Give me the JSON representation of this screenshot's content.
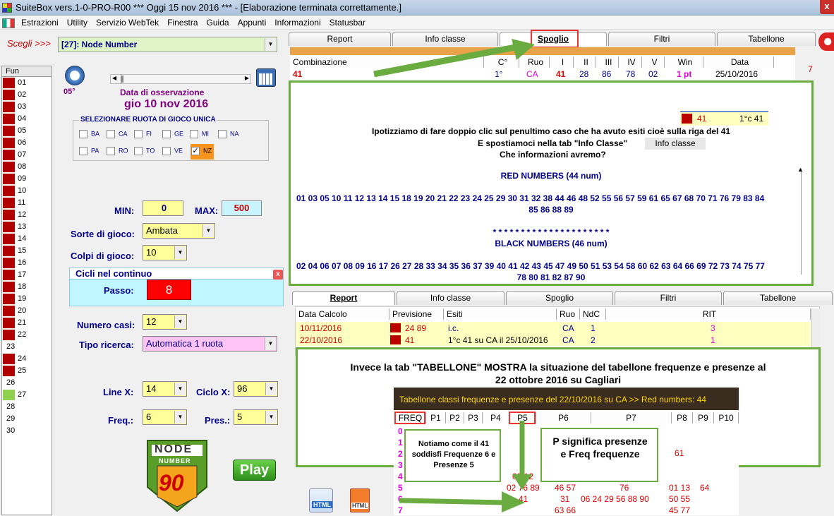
{
  "window": {
    "title": "SuiteBox vers.1-0-PRO-R00  ***  Oggi 15 nov 2016  ***  - [Elaborazione terminata correttamente.]",
    "close_glyph": "x"
  },
  "menu": {
    "items": [
      "Estrazioni",
      "Utility",
      "Servizio WebTek",
      "Finestra",
      "Guida",
      "Appunti",
      "Informazioni",
      "Statusbar"
    ]
  },
  "left": {
    "scegli_label": "Scegli >>>",
    "scegli_value": "[27]: Node Number",
    "degree": "05°",
    "data_label": "Data di osservazione",
    "data_value": "gio 10 nov 2016",
    "ruota_title": "SELEZIONARE RUOTA DI GIOCO UNICA",
    "ruote": [
      "BA",
      "CA",
      "FI",
      "GE",
      "MI",
      "NA",
      "PA",
      "RO",
      "TO",
      "VE",
      "NZ"
    ],
    "min_label": "MIN:",
    "min_value": "0",
    "max_label": "MAX:",
    "max_value": "500",
    "sorte_label": "Sorte di gioco:",
    "sorte_value": "Ambata",
    "colpi_label": "Colpi di gioco:",
    "colpi_value": "10",
    "cicli_title": "Cicli nel continuo",
    "passo_label": "Passo:",
    "passo_value": "8",
    "numero_label": "Numero casi:",
    "numero_value": "12",
    "tipo_label": "Tipo ricerca:",
    "tipo_value": "Automatica 1 ruota",
    "linex_label": "Line X:",
    "linex_value": "14",
    "ciclox_label": "Ciclo X:",
    "ciclox_value": "96",
    "freq_label": "Freq.:",
    "freq_value": "6",
    "pres_label": "Pres.:",
    "pres_value": "5",
    "logo_top": "NODE",
    "logo_mid": "NUMBER",
    "logo_num": "90",
    "play_label": "Play",
    "close_x": "x"
  },
  "fun": {
    "header": "Fun",
    "rows": [
      "01",
      "02",
      "03",
      "04",
      "05",
      "06",
      "07",
      "08",
      "09",
      "10",
      "11",
      "12",
      "13",
      "14",
      "15",
      "16",
      "17",
      "18",
      "19",
      "20",
      "21",
      "22",
      "23",
      "24",
      "25",
      "26",
      "27",
      "28",
      "29",
      "30"
    ]
  },
  "top_tabs": [
    "Report",
    "Info classe",
    "Spoglio",
    "Filtri",
    "Tabellone"
  ],
  "top_table": {
    "headers": [
      "Combinazione",
      "C°",
      "Ruo",
      "I",
      "II",
      "III",
      "IV",
      "V",
      "Win",
      "Data"
    ],
    "row": [
      "41",
      "1°",
      "CA",
      "41",
      "28",
      "86",
      "78",
      "02",
      "1 pt",
      "25/10/2016"
    ]
  },
  "side_number": "7",
  "info": {
    "mini_num": "41",
    "mini_esito": "1°c 41",
    "line1": "Ipotizziamo di fare doppio clic sul penultimo caso che ha avuto esiti cioè sulla riga del 41",
    "line2": "E spostiamoci nella tab \"Info Classe\"",
    "tab_btn": "Info classe",
    "line3": "Che informazioni avremo?",
    "red_title": "RED NUMBERS (44 num)",
    "red_line1": "01 03 05 10 11 12 13 14 15 18 19 20 21 22 23 24 25 29 30 31 32 38 44 46 48 52 55 56 57 59 61 65 67 68 70 71 76 79 83 84",
    "red_line2": "85 86 88 89",
    "stars": "* * * * * * * * * * * * * * * * * * * * *",
    "black_title": "BLACK NUMBERS (46 num)",
    "black_line1": "02 04 06 07 08 09 16 17 26 27 28 33 34 35 36 37 39 40 41 42 43 45 47 49 50 51 53 54 58 60 62 63 64 66 69 72 73 74 75 77",
    "black_line2": "78 80 81 82 87 90"
  },
  "bottom_tabs": [
    "Report",
    "Info classe",
    "Spoglio",
    "Filtri",
    "Tabellone"
  ],
  "bottom_table": {
    "headers": [
      "Data Calcolo",
      "Previsione",
      "Esiti",
      "Ruo",
      "NdC",
      "RIT"
    ],
    "rows": [
      [
        "10/11/2016",
        "24 89",
        "i.c.",
        "CA",
        "1",
        "3"
      ],
      [
        "22/10/2016",
        "41",
        "1°c 41 su CA il 25/10/2016",
        "CA",
        "2",
        "1"
      ]
    ]
  },
  "tabellone": {
    "intro1": "Invece la tab \"TABELLONE\" MOSTRA la situazione del tabellone frequenze e presenze al",
    "intro2": "22 ottobre 2016 su Cagliari",
    "title": "Tabellone classi frequenze e presenze del 22/10/2016 su CA >> Red numbers: 44",
    "headers": [
      "FREQ",
      "P1",
      "P2",
      "P3",
      "P4",
      "P5",
      "P6",
      "P7",
      "P8",
      "P9",
      "P10"
    ],
    "freq_col": [
      "0",
      "1",
      "2",
      "3",
      "4",
      "5",
      "6",
      "7"
    ],
    "cells": {
      "r2_p8": "61",
      "r4_p5": "02 12",
      "r5_p5": "02 76 89",
      "r5_p6": "46 57",
      "r5_p7": "76",
      "r5_p8": "01 13",
      "r5_p9": "64",
      "r6_p5": "41",
      "r6_p6": "31",
      "r6_p7": "06 24 29 56 88 90",
      "r6_p8": "50 55",
      "r7_p6": "63 66",
      "r7_p8": "45 77"
    },
    "note1": "Notiamo come il 41 soddisfi Frequenze 6 e Presenze 5",
    "note2": "P significa presenze e Freq frequenze"
  },
  "html_icon": "HTML",
  "html_icon2": "HTML"
}
